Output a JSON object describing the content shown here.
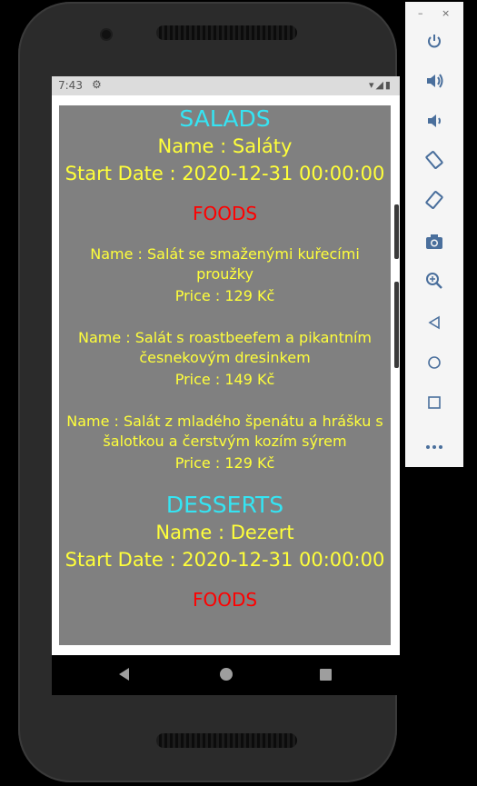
{
  "status_bar": {
    "time": "7:43",
    "settings_icon": "gear-icon",
    "right_icons": "▾◢▮"
  },
  "categories": [
    {
      "title": "SALADS",
      "name_line": "Name : Saláty",
      "start_line": "Start Date : 2020-12-31 00:00:00",
      "foods_label": "FOODS",
      "foods": [
        {
          "name": "Name : Salát se smaženými kuřecími proužky",
          "price": "Price : 129 Kč"
        },
        {
          "name": "Name : Salát s roastbeefem a pikantním česnekovým dresinkem",
          "price": "Price : 149 Kč"
        },
        {
          "name": "Name : Salát z mladého špenátu a hrášku s šalotkou a čerstvým kozím sýrem",
          "price": "Price : 129 Kč"
        }
      ]
    },
    {
      "title": "DESSERTS",
      "name_line": "Name : Dezert",
      "start_line": "Start Date : 2020-12-31 00:00:00",
      "foods_label": "FOODS",
      "foods": []
    }
  ],
  "emulator_toolbar": {
    "minimize": "–",
    "close": "×",
    "buttons": [
      {
        "name": "power-icon",
        "glyph": "⏻"
      },
      {
        "name": "volume-up-icon",
        "glyph": "🔊"
      },
      {
        "name": "volume-down-icon",
        "glyph": "🔉"
      },
      {
        "name": "rotate-left-icon",
        "glyph": "⟲"
      },
      {
        "name": "rotate-right-icon",
        "glyph": "⟳"
      },
      {
        "name": "camera-icon",
        "glyph": "📷"
      },
      {
        "name": "zoom-icon",
        "glyph": "⊕"
      },
      {
        "name": "back-icon",
        "glyph": "◁"
      },
      {
        "name": "home-icon",
        "glyph": "○"
      },
      {
        "name": "overview-icon",
        "glyph": "□"
      },
      {
        "name": "more-icon",
        "glyph": "⋯"
      }
    ]
  },
  "colors": {
    "category_title": "#35e4f3",
    "text": "#ffff3a",
    "foods_label": "#ff0000",
    "panel": "#808080"
  }
}
